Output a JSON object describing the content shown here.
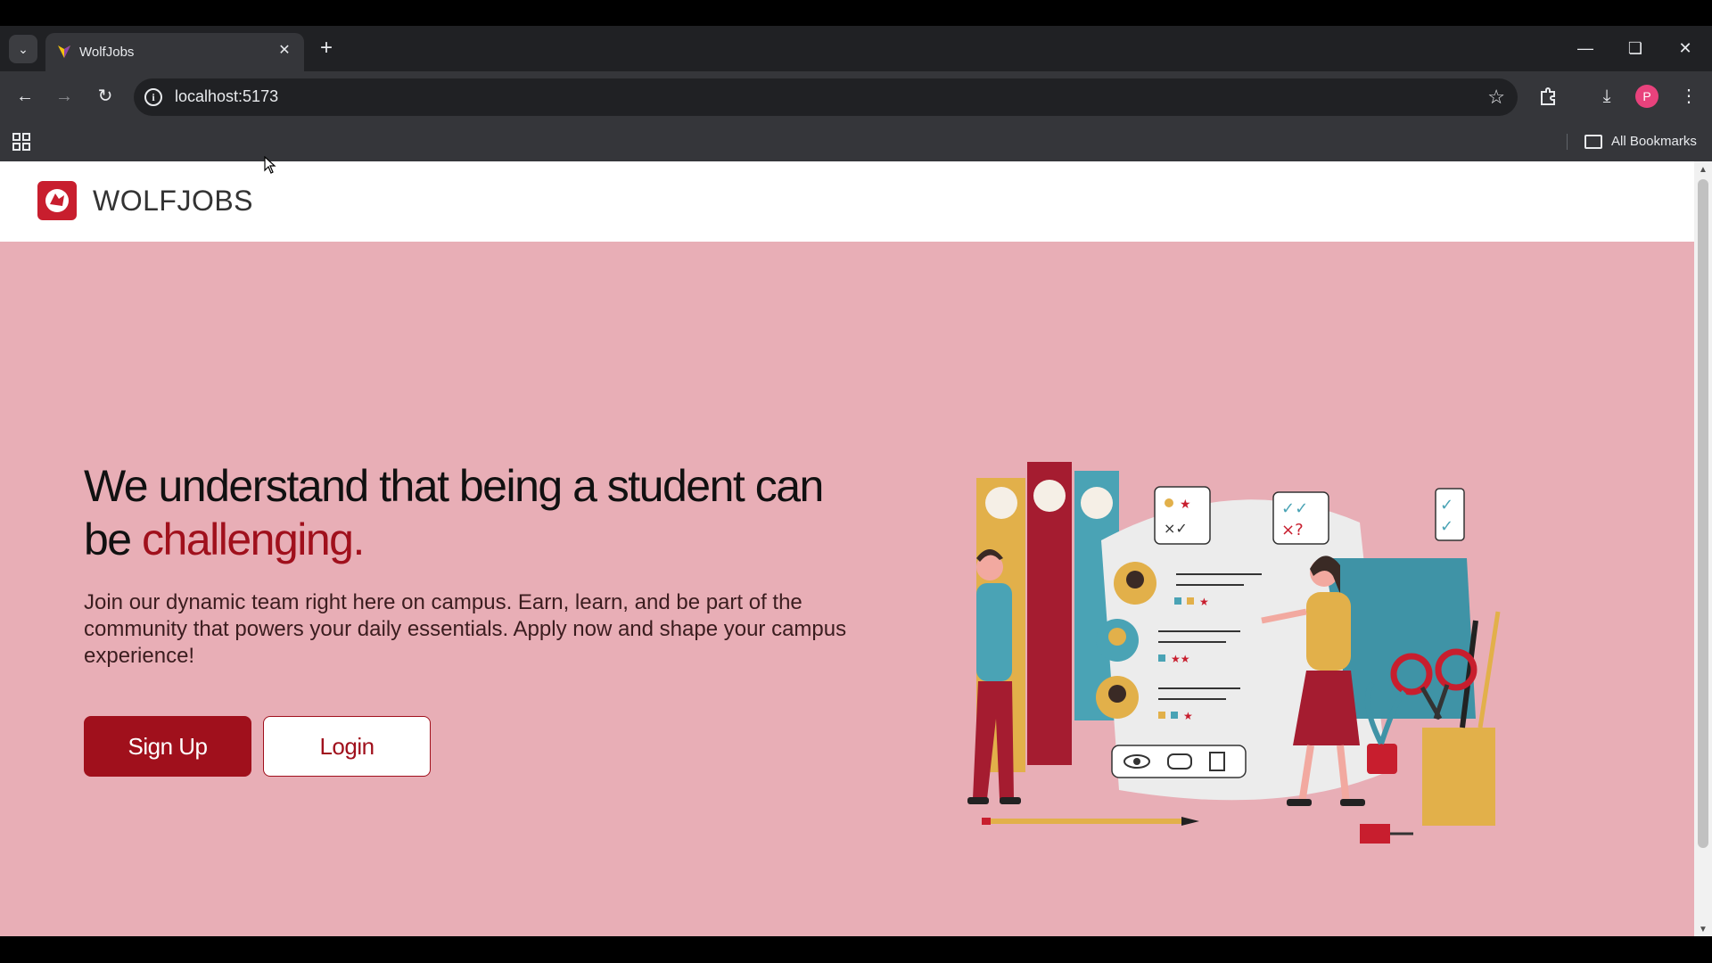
{
  "browser": {
    "tab_title": "WolfJobs",
    "url": "localhost:5173",
    "bookmarks_label": "All Bookmarks",
    "profile_initial": "P"
  },
  "page": {
    "brand": "WOLFJOBS",
    "headline_main": "We understand that being a student can be ",
    "headline_accent": "challenging.",
    "subtext": "Join our dynamic team right here on campus. Earn, learn, and be part of the community that powers your daily essentials. Apply now and shape your campus experience!",
    "signup_label": "Sign Up",
    "login_label": "Login"
  },
  "colors": {
    "accent": "#a0101c",
    "page_background": "#e8aeb6",
    "header_background": "#ffffff"
  }
}
